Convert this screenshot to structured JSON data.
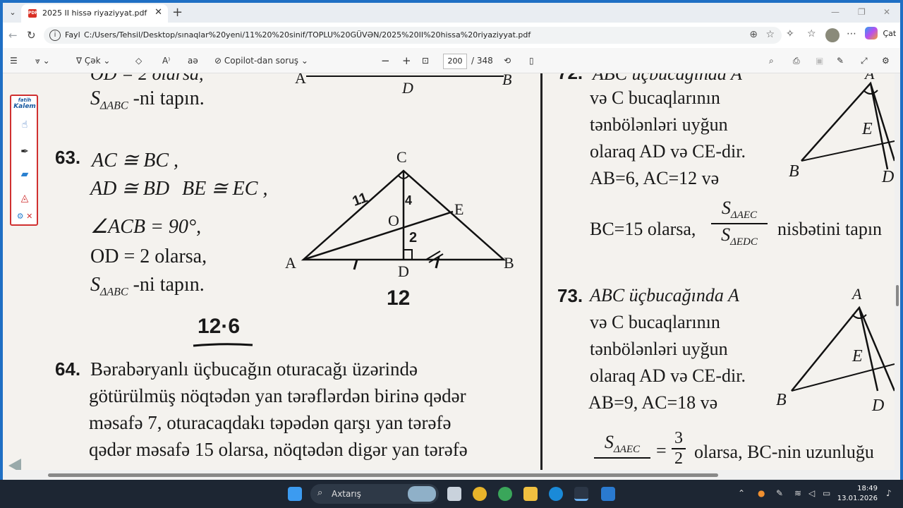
{
  "tab": {
    "title": "2025 II hissə riyaziyyat.pdf",
    "icon": "pdf-icon"
  },
  "address": {
    "label": "Fayl",
    "url": "C:/Users/Tehsil/Desktop/sınaqlar%20yeni/11%20%20sinif/TOPLU%20GÜVƏN/2025%20II%20hissa%20riyaziyyat.pdf",
    "copilot_label": "Çat"
  },
  "pdf_toolbar": {
    "draw_label": "Çək",
    "copilot_label": "Copilot-dan soruş",
    "page_current": "200",
    "page_total": "/ 348"
  },
  "page": {
    "top_left_fragment": "OD = 2 olarsa,",
    "top_left_find": "-ni tapın.",
    "top_tri_labels": {
      "a": "A",
      "d": "D",
      "b": "B"
    },
    "p63": {
      "number": "63.",
      "line1": "AC ≅ BC ,",
      "line2a": "AD ≅ BD",
      "line2b": "BE ≅ EC ,",
      "line3": "∠ACB = 90°,",
      "line4": "OD = 2  olarsa,",
      "line5_s": "S",
      "line5_sub": "ΔABC",
      "line5_rest": "-ni tapın.",
      "fig": {
        "c": "C",
        "a": "A",
        "b": "B",
        "d": "D",
        "e": "E",
        "o": "O"
      }
    },
    "handwriting": {
      "eleven": "11",
      "four": "4",
      "two": "2",
      "twelve": "12",
      "product": "12·6"
    },
    "p64": {
      "number": "64.",
      "line1": "Bərabəryanlı üçbucağın oturacağı üzərində",
      "line2": "götürülmüş nöqtədən yan tərəflərdən birinə qədər",
      "line3": "məsafə 7, oturacaqdakı təpədən qarşı yan tərəfə",
      "line4": "qədər məsafə 15 olarsa, nöqtədən digər yan tərəfə"
    },
    "p72": {
      "number": "72.",
      "line0": "ABC üçbucağında A",
      "line1": "və C bucaqlarının",
      "line2": "tənbölənləri uyğun",
      "line3": "olaraq AD və CE-dir.",
      "line4": "AB=6, AC=12 və",
      "line5": "BC=15 olarsa,",
      "frac_num": "S",
      "frac_num_sub": "ΔAEC",
      "frac_den": "S",
      "frac_den_sub": "ΔEDC",
      "line5_end": "nisbətini tapın",
      "fig": {
        "a": "A",
        "e": "E",
        "b": "B",
        "d": "D"
      }
    },
    "p73": {
      "number": "73.",
      "line0": "ABC üçbucağında A",
      "line1": "və C bucaqlarının",
      "line2": "tənbölənləri uyğun",
      "line3": "olaraq AD və CE-dir.",
      "line4": "AB=9, AC=18 və",
      "frac_num": "S",
      "frac_num_sub": "ΔAEC",
      "eq": "=",
      "r_num": "3",
      "r_den": "2",
      "line5_end": "olarsa, BC-nin uzunluğu",
      "fig": {
        "a": "A",
        "e": "E",
        "b": "B",
        "d": "D"
      }
    }
  },
  "palette": {
    "logo_top": "fatih",
    "logo_bottom": "Kalem"
  },
  "taskbar": {
    "search_label": "Axtarış",
    "time": "18:49",
    "date": "13.01.2026"
  }
}
